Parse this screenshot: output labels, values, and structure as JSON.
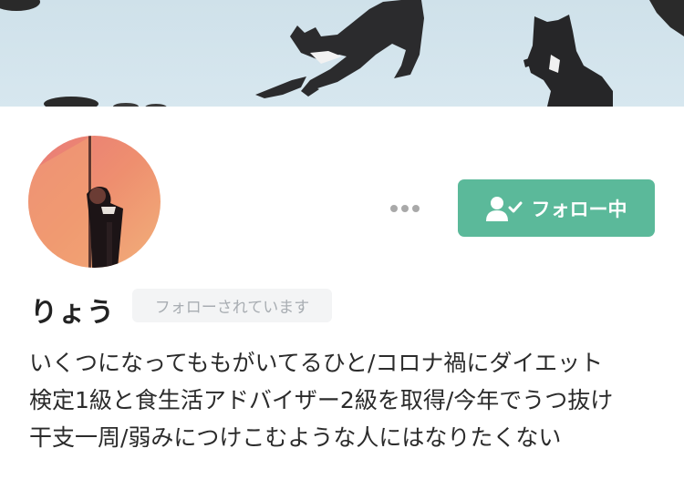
{
  "profile": {
    "display_name": "りょう",
    "follows_you_label": "フォローされています",
    "bio_lines": [
      "いくつになってももがいてるひと/コロナ禍にダイエット",
      "検定1級と食生活アドバイザー2級を取得/今年でうつ抜け",
      "干支一周/弱みにつけこむような人にはなりたくない"
    ]
  },
  "actions": {
    "follow_label": "フォロー中",
    "follow_icon": "user-check-icon",
    "more_icon": "more-dots-icon"
  },
  "colors": {
    "accent": "#5bb99a",
    "badge_bg": "#f3f4f5",
    "badge_text": "#a8adb2",
    "cover_bg": "#d3e4ec"
  }
}
